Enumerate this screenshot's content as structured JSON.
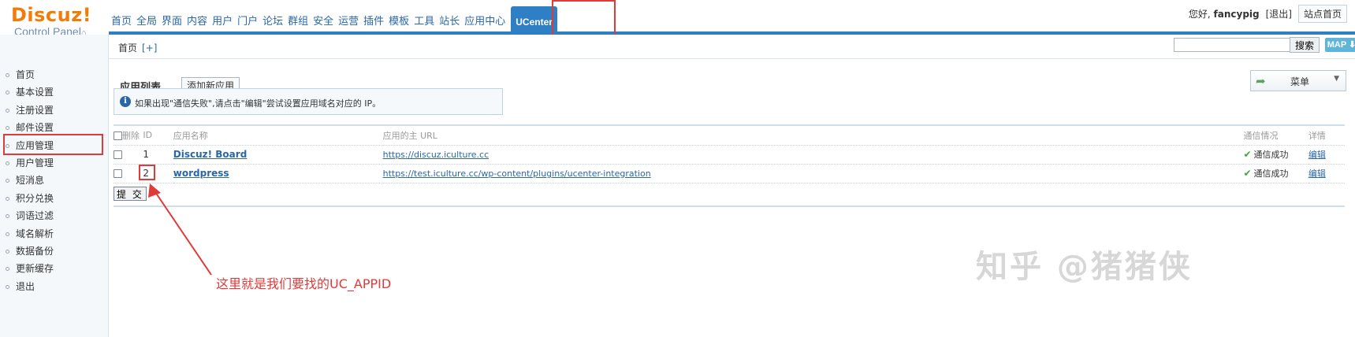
{
  "header": {
    "logo_brand": "Discuz!",
    "logo_sub": "Control Panel",
    "nav": [
      "首页",
      "全局",
      "界面",
      "内容",
      "用户",
      "门户",
      "论坛",
      "群组",
      "安全",
      "运营",
      "插件",
      "模板",
      "工具",
      "站长",
      "应用中心"
    ],
    "nav_active": "UCenter",
    "greeting": "您好,",
    "username": "fancypig",
    "logout": "[退出]",
    "site_home": "站点首页"
  },
  "crumb": {
    "home": "首页",
    "plus": "[+]",
    "search_button": "搜索",
    "map_button": "MAP"
  },
  "sidebar": {
    "items": [
      "首页",
      "基本设置",
      "注册设置",
      "邮件设置",
      "应用管理",
      "用户管理",
      "短消息",
      "积分兑换",
      "词语过滤",
      "域名解析",
      "数据备份",
      "更新缓存",
      "退出"
    ]
  },
  "main": {
    "section_title": "应用列表",
    "add_app": "添加新应用",
    "menu_label": "菜单",
    "tip": "如果出现\"通信失败\",请点击\"编辑\"尝试设置应用域名对应的 IP。",
    "columns": {
      "delete": "删除",
      "id": "ID",
      "name": "应用名称",
      "url": "应用的主 URL",
      "comm": "通信情况",
      "detail": "详情"
    },
    "rows": [
      {
        "id": "1",
        "name": "Discuz! Board",
        "url": "https://discuz.iculture.cc",
        "status": "通信成功",
        "edit": "编辑"
      },
      {
        "id": "2",
        "name": "wordpress",
        "url": "https://test.iculture.cc/wp-content/plugins/ucenter-integration",
        "status": "通信成功",
        "edit": "编辑"
      }
    ],
    "submit": "提 交"
  },
  "annotation": {
    "text": "这里就是我们要找的UC_APPID",
    "color": "#e03a3a"
  },
  "watermark": "知乎 @猪猪侠"
}
